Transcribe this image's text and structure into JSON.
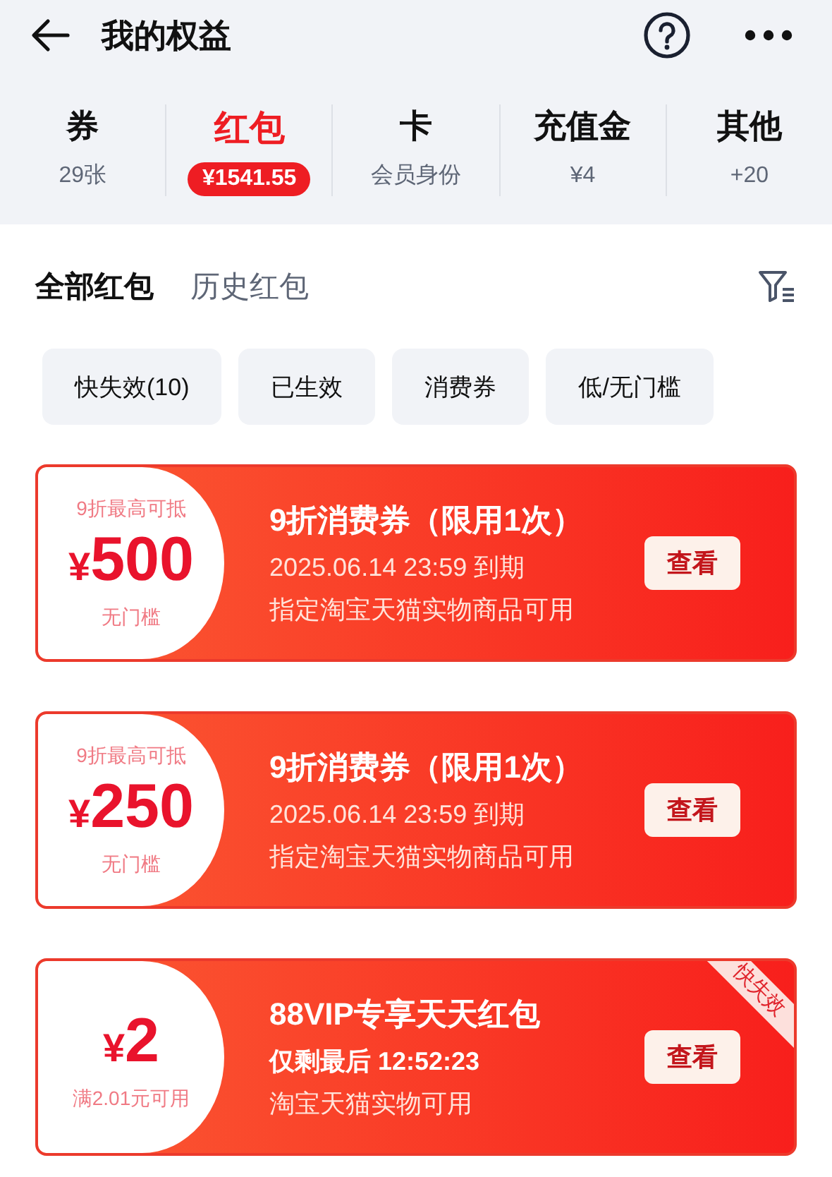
{
  "header": {
    "title": "我的权益"
  },
  "categories": [
    {
      "label": "券",
      "value": "29张",
      "selected": false
    },
    {
      "label": "红包",
      "value": "¥1541.55",
      "selected": true
    },
    {
      "label": "卡",
      "value": "会员身份",
      "selected": false
    },
    {
      "label": "充值金",
      "value": "¥4",
      "selected": false
    },
    {
      "label": "其他",
      "value": "+20",
      "selected": false
    }
  ],
  "tabs": [
    {
      "label": "全部红包",
      "selected": true
    },
    {
      "label": "历史红包",
      "selected": false
    }
  ],
  "chips": [
    {
      "label": "快失效(10)"
    },
    {
      "label": "已生效"
    },
    {
      "label": "消费券"
    },
    {
      "label": "低/无门槛"
    }
  ],
  "cards": [
    {
      "kind": "voucher",
      "note": "9折最高可抵",
      "currency": "¥",
      "amount": "500",
      "condition": "无门槛",
      "title": "9折消费券（限用1次）",
      "line_2": "2025.06.14 23:59 到期",
      "line_3": "指定淘宝天猫实物商品可用",
      "button": "查看"
    },
    {
      "kind": "voucher",
      "note": "9折最高可抵",
      "currency": "¥",
      "amount": "250",
      "condition": "无门槛",
      "title": "9折消费券（限用1次）",
      "line_2": "2025.06.14 23:59 到期",
      "line_3": "指定淘宝天猫实物商品可用",
      "button": "查看"
    },
    {
      "kind": "countdown",
      "currency": "¥",
      "amount": "2",
      "condition": "满2.01元可用",
      "title": "88VIP专享天天红包",
      "line_2": "仅剩最后 12:52:23",
      "line_3": "淘宝天猫实物可用",
      "button": "查看",
      "badge": "快失效"
    }
  ]
}
